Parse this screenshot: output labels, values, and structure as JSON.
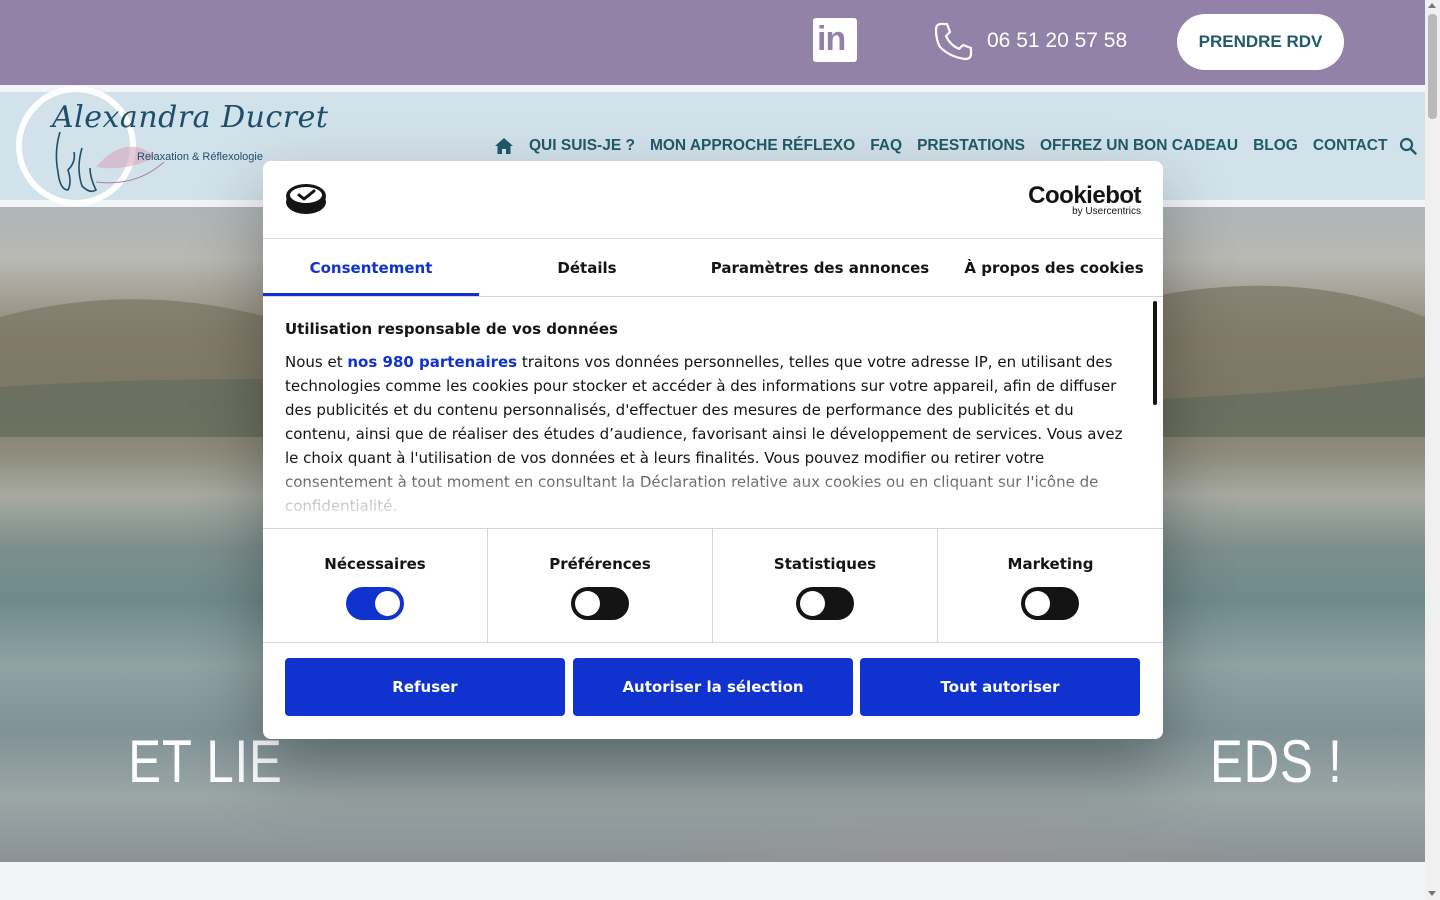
{
  "topbar": {
    "linkedin_icon": "linkedin-icon",
    "linkedin_text": "in",
    "phone_icon": "phone-icon",
    "phone": "06 51 20 57 58",
    "rdv_label": "PRENDRE RDV",
    "background": "#9282a8"
  },
  "header": {
    "logo_name": "Alexandra Ducret",
    "logo_sub": "Relaxation & Réflexologie",
    "nav": [
      "QUI SUIS-JE ?",
      "MON APPROCHE RÉFLEXO",
      "FAQ",
      "PRESTATIONS",
      "OFFREZ UN BON CADEAU",
      "BLOG",
      "CONTACT"
    ],
    "icons": [
      "home-icon",
      "search-icon"
    ]
  },
  "hero": {
    "title": "ET LIE                                                                EDS !"
  },
  "cookie_dialog": {
    "brand": "Cookiebot",
    "brand_sub": "by Usercentrics",
    "tabs": [
      "Consentement",
      "Détails",
      "Paramètres des annonces",
      "À propos des cookies"
    ],
    "active_tab": "Consentement",
    "heading": "Utilisation responsable de vos données",
    "body_before_link": "Nous et ",
    "body_link": "nos 980 partenaires",
    "body_after_link": " traitons vos données personnelles, telles que votre adresse IP, en utilisant des technologies comme les cookies pour stocker et accéder à des informations sur votre appareil, afin de diffuser des publicités et du contenu personnalisés, d'effectuer des mesures de performance des publicités et du contenu, ainsi que de réaliser des études d’audience, favorisant ainsi le développement de services. Vous avez le choix quant à l'utilisation de vos données et à leurs finalités. Vous pouvez modifier ou retirer votre consentement à tout moment en consultant la Déclaration relative aux cookies ou en cliquant sur l'icône de confidentialité.",
    "toggles": [
      {
        "label": "Nécessaires",
        "on": true
      },
      {
        "label": "Préférences",
        "on": false
      },
      {
        "label": "Statistiques",
        "on": false
      },
      {
        "label": "Marketing",
        "on": false
      }
    ],
    "buttons": {
      "refuse": "Refuser",
      "allow_selection": "Autoriser la sélection",
      "allow_all": "Tout autoriser"
    },
    "accent": "#1032cf"
  }
}
